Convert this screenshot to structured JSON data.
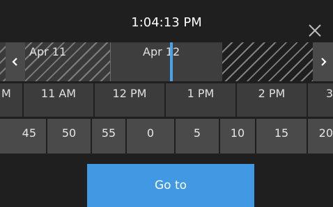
{
  "header": {
    "time": "1:04:13 PM"
  },
  "date_strip": {
    "days": [
      "Apr 11",
      "Apr 12"
    ]
  },
  "hours": [
    "M",
    "11 AM",
    "12 PM",
    "1 PM",
    "2 PM",
    "3"
  ],
  "minutes": [
    "45",
    "50",
    "55",
    "0",
    "5",
    "10",
    "15",
    "20"
  ],
  "actions": {
    "goto_label": "Go to"
  },
  "colors": {
    "accent": "#4099e2",
    "now_marker": "#4aa3ea",
    "background": "#1f1f1f"
  },
  "icons": {
    "close": "close-icon",
    "prev": "chevron-left-icon",
    "next": "chevron-right-icon"
  }
}
